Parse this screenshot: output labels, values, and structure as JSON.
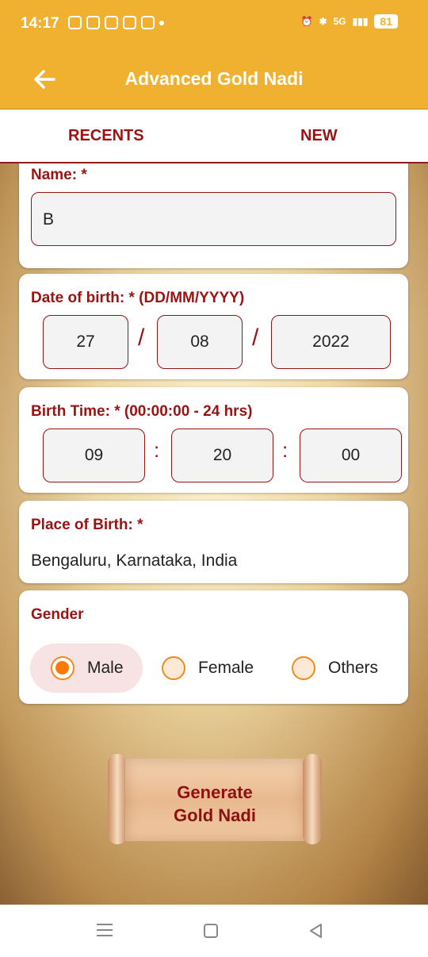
{
  "status_bar": {
    "time": "14:17",
    "battery": "81",
    "network": "5G"
  },
  "app_bar": {
    "title": "Advanced Gold Nadi"
  },
  "tabs": [
    {
      "label": "RECENTS"
    },
    {
      "label": "NEW"
    }
  ],
  "form": {
    "name": {
      "label": "Name: *",
      "value": "B"
    },
    "dob": {
      "label": "Date of birth: * (DD/MM/YYYY)",
      "day": "27",
      "month": "08",
      "year": "2022",
      "separator": "/"
    },
    "time": {
      "label": "Birth Time: * (00:00:00 - 24 hrs)",
      "hours": "09",
      "minutes": "20",
      "seconds": "00",
      "separator": ":"
    },
    "place": {
      "label": "Place of Birth: *",
      "value": "Bengaluru, Karnataka, India"
    },
    "gender": {
      "label": "Gender",
      "options": [
        {
          "label": "Male",
          "selected": true
        },
        {
          "label": "Female",
          "selected": false
        },
        {
          "label": "Others",
          "selected": false
        }
      ]
    }
  },
  "generate_button": {
    "line1": "Generate",
    "line2": "Gold Nadi"
  },
  "colors": {
    "accent": "#EFB12F",
    "label": "#9a1313",
    "radio": "#ff7a00"
  }
}
